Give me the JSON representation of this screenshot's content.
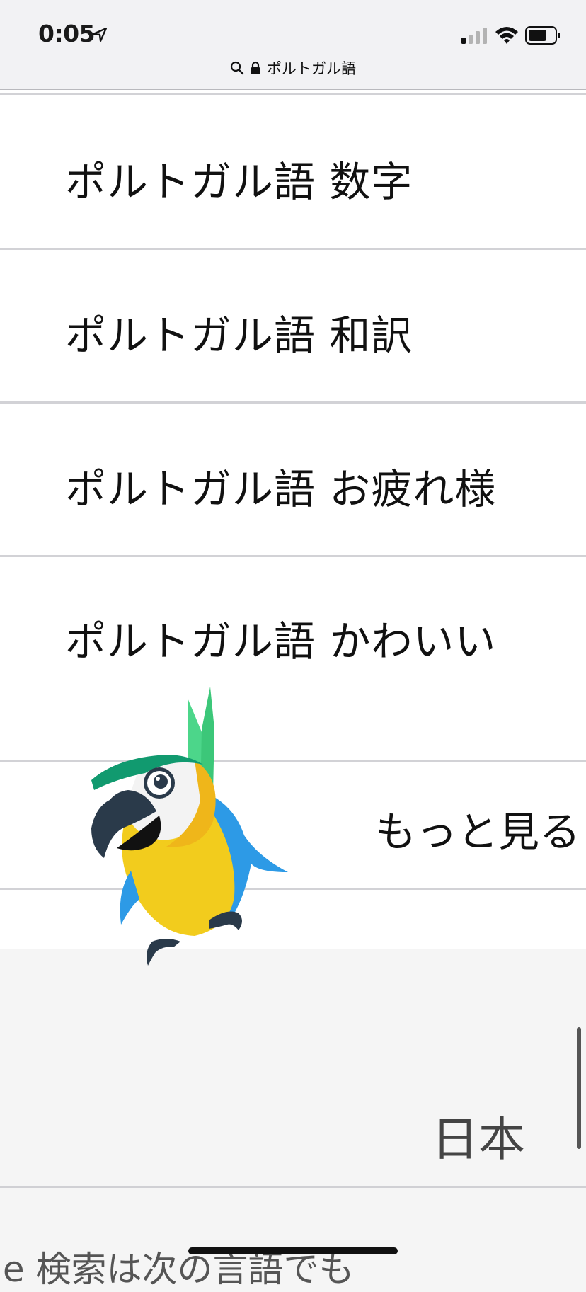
{
  "status_bar": {
    "time": "0:05"
  },
  "url_bar": {
    "text": "ポルトガル語"
  },
  "list": {
    "items": [
      {
        "label": "ポルトガル語 数字"
      },
      {
        "label": "ポルトガル語 和訳"
      },
      {
        "label": "ポルトガル語 お疲れ様"
      },
      {
        "label": "ポルトガル語 かわいい"
      }
    ],
    "more_label": "もっと見る"
  },
  "footer": {
    "language": "日本",
    "text": "le 検索は次の言語でも"
  },
  "colors": {
    "parrot_yellow": "#f2cc1d",
    "parrot_blue": "#2d9ae6",
    "parrot_green": "#4cd68a",
    "parrot_teal": "#119a6f"
  }
}
